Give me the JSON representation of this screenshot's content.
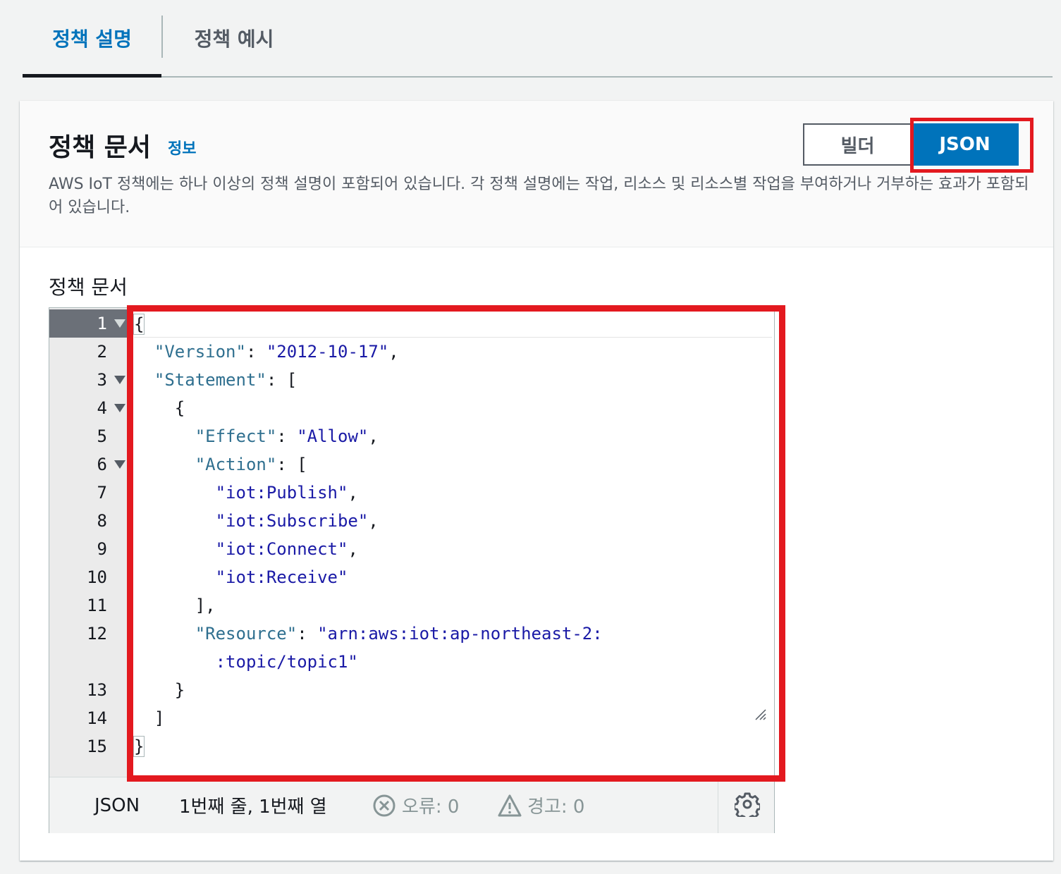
{
  "tabs": [
    {
      "label": "정책 설명",
      "active": true
    },
    {
      "label": "정책 예시",
      "active": false
    }
  ],
  "panel": {
    "title": "정책 문서",
    "info_link": "정보",
    "description": "AWS IoT 정책에는 하나 이상의 정책 설명이 포함되어 있습니다. 각 정책 설명에는 작업, 리소스 및 리소스별 작업을 부여하거나 거부하는 효과가 포함되어 있습니다.",
    "mode_toggle": {
      "builder": "빌더",
      "json": "JSON",
      "selected": "JSON"
    }
  },
  "editor": {
    "label": "정책 문서",
    "line_numbers": [
      "1",
      "2",
      "3",
      "4",
      "5",
      "6",
      "7",
      "8",
      "9",
      "10",
      "11",
      "12",
      "",
      "13",
      "14",
      "15"
    ],
    "foldable_lines": [
      "1",
      "3",
      "4",
      "6"
    ],
    "active_line": "1",
    "code": {
      "l1": "{",
      "l2_key": "\"Version\"",
      "l2_colon": ": ",
      "l2_val": "\"2012-10-17\"",
      "l2_end": ",",
      "l3_key": "\"Statement\"",
      "l3_rest": ": [",
      "l4": "{",
      "l5_key": "\"Effect\"",
      "l5_colon": ": ",
      "l5_val": "\"Allow\"",
      "l5_end": ",",
      "l6_key": "\"Action\"",
      "l6_rest": ": [",
      "l7_val": "\"iot:Publish\"",
      "l7_end": ",",
      "l8_val": "\"iot:Subscribe\"",
      "l8_end": ",",
      "l9_val": "\"iot:Connect\"",
      "l9_end": ",",
      "l10_val": "\"iot:Receive\"",
      "l11": "],",
      "l12_key": "\"Resource\"",
      "l12_colon": ": ",
      "l12_val": "\"arn:aws:iot:ap-northeast-2:",
      "l12b_val": ":topic/topic1\"",
      "l13": "}",
      "l14": "]",
      "l15": "}"
    },
    "status": {
      "language": "JSON",
      "cursor": "1번째 줄, 1번째 열",
      "errors": "오류: 0",
      "warnings": "경고: 0"
    }
  },
  "colors": {
    "accent": "#0073bb",
    "highlight_box": "#e3191f",
    "json_key": "#2f6f8f",
    "json_string": "#1a1aa6"
  }
}
